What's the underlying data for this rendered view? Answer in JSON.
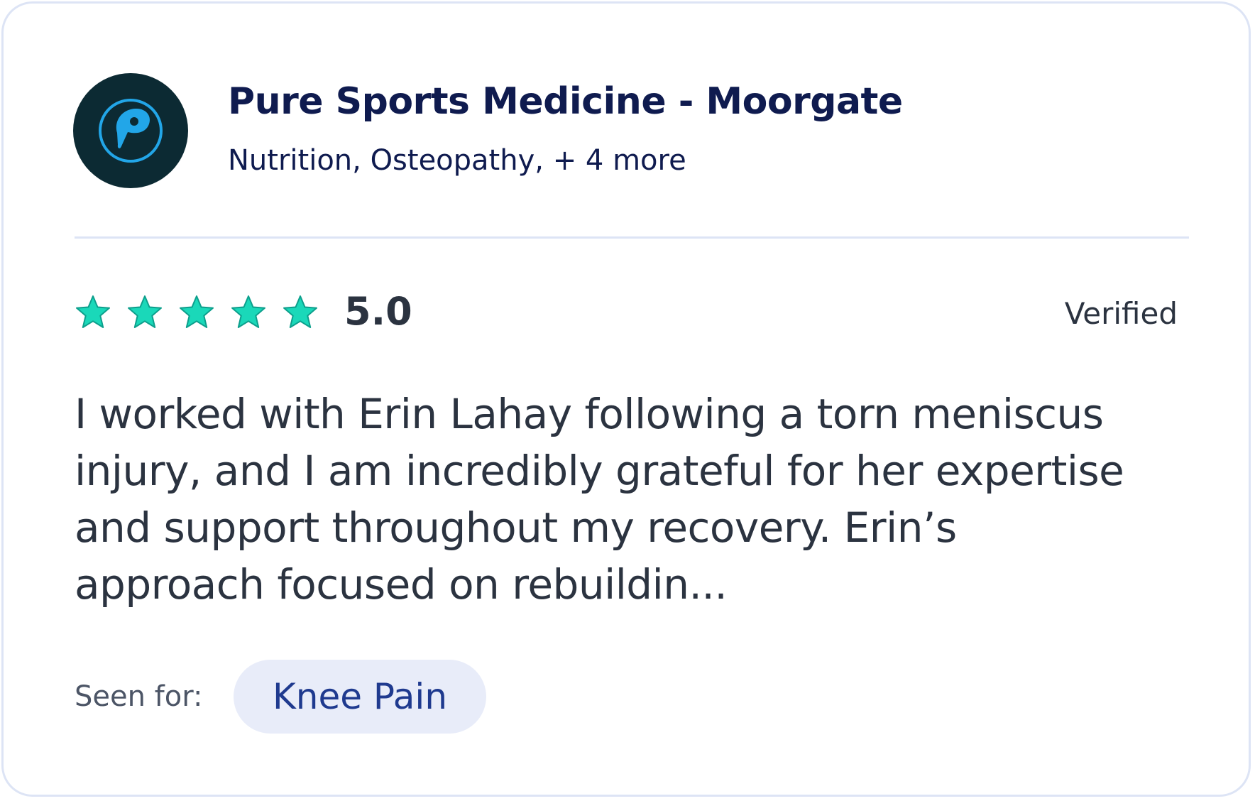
{
  "clinic": {
    "name": "Pure Sports Medicine - Moorgate",
    "services": "Nutrition, Osteopathy, + 4 more",
    "logo_icon": "pure-sports-medicine-logo-icon"
  },
  "rating": {
    "value": "5.0",
    "stars": 5,
    "max_stars": 5,
    "star_color": "#1ad8b9",
    "star_outline": "#0d9f8c"
  },
  "status": {
    "verified_label": "Verified"
  },
  "review": {
    "lines": [
      "I worked with Erin Lahay following a torn meniscus",
      "injury, and I am incredibly grateful for her expertise",
      "and support throughout my recovery. Erin’s",
      "approach focused on rebuildin..."
    ]
  },
  "seen_for": {
    "label": "Seen for:",
    "condition": "Knee Pain"
  },
  "colors": {
    "brand_dark": "#0f1b4f",
    "text": "#2b3340",
    "chip_bg": "#e8ecf9",
    "chip_text": "#1f3a8f",
    "logo_bg": "#0c2a33",
    "logo_accent": "#22a6e8",
    "border": "#dde4f5"
  }
}
